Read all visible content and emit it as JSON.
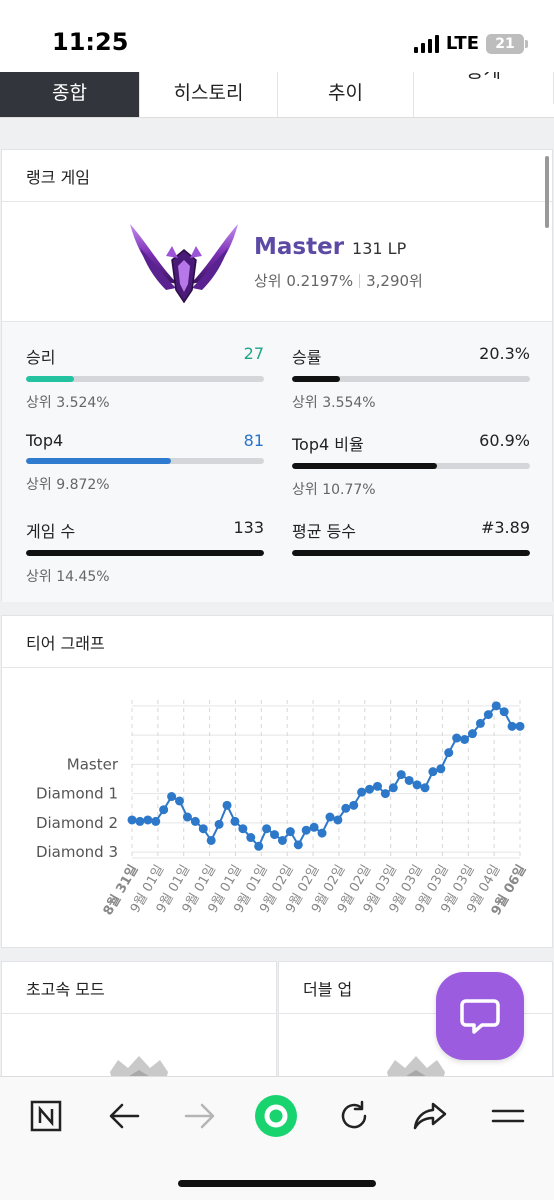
{
  "status_bar": {
    "time": "11:25",
    "network": "LTE",
    "battery": "21"
  },
  "tabs": [
    {
      "label": "종합",
      "active": true
    },
    {
      "label": "히스토리",
      "active": false
    },
    {
      "label": "추이",
      "active": false
    },
    {
      "label": "통계",
      "active": false
    }
  ],
  "rank": {
    "title": "랭크 게임",
    "tier": "Master",
    "lp": "131 LP",
    "top_percent": "상위 0.2197%",
    "rank_position": "3,290위",
    "stats": [
      {
        "label": "승리",
        "value": "27",
        "value_color": "#1fa48a",
        "bar_fraction": 0.203,
        "bar_color": "#23c2a0",
        "sub": "상위 3.524%"
      },
      {
        "label": "승률",
        "value": "20.3%",
        "value_color": "#222222",
        "bar_fraction": 0.203,
        "bar_color": "#111111",
        "sub": "상위 3.554%"
      },
      {
        "label": "Top4",
        "value": "81",
        "value_color": "#2a73c8",
        "bar_fraction": 0.609,
        "bar_color": "#2f7bd0",
        "sub": "상위 9.872%"
      },
      {
        "label": "Top4 비율",
        "value": "60.9%",
        "value_color": "#222222",
        "bar_fraction": 0.609,
        "bar_color": "#111111",
        "sub": "상위 10.77%"
      },
      {
        "label": "게임 수",
        "value": "133",
        "value_color": "#222222",
        "bar_fraction": 1.0,
        "bar_color": "#111111",
        "sub": "상위 14.45%"
      },
      {
        "label": "평균 등수",
        "value": "#3.89",
        "value_color": "#222222",
        "bar_fraction": 1.0,
        "bar_color": "#111111",
        "sub": ""
      }
    ]
  },
  "graph_title": "티어 그래프",
  "chart_data": {
    "type": "line",
    "title": "티어 그래프",
    "xlabel": "",
    "ylabel": "",
    "y_tick_labels": [
      "Diamond 3",
      "Diamond 2",
      "Diamond 1",
      "Master"
    ],
    "y_tick_values": [
      0,
      1,
      2,
      3
    ],
    "ylim": [
      -0.2,
      5.2
    ],
    "x_tick_labels": [
      "8월 31일",
      "9월 01일",
      "9월 01일",
      "9월 01일",
      "9월 01일",
      "9월 01일",
      "9월 02일",
      "9월 02일",
      "9월 02일",
      "9월 02일",
      "9월 03일",
      "9월 03일",
      "9월 03일",
      "9월 03일",
      "9월 04일",
      "9월 06일"
    ],
    "x_tick_bold": [
      true,
      false,
      false,
      false,
      false,
      false,
      false,
      false,
      false,
      false,
      false,
      false,
      false,
      false,
      false,
      true
    ],
    "series": [
      {
        "values": [
          1.1,
          1.05,
          1.1,
          1.05,
          1.45,
          1.9,
          1.75,
          1.2,
          1.05,
          0.8,
          0.4,
          0.95,
          1.6,
          1.05,
          0.8,
          0.5,
          0.2,
          0.8,
          0.6,
          0.4,
          0.7,
          0.25,
          0.75,
          0.85,
          0.65,
          1.2,
          1.1,
          1.5,
          1.6,
          2.05,
          2.15,
          2.25,
          2.0,
          2.2,
          2.65,
          2.45,
          2.3,
          2.2,
          2.75,
          2.85,
          3.4,
          3.9,
          3.85,
          4.05,
          4.4,
          4.7,
          5.0,
          4.8,
          4.3,
          4.3
        ]
      }
    ],
    "grid": true,
    "color": "#2d78c8"
  },
  "bottom_cards": [
    {
      "title": "초고속 모드"
    },
    {
      "title": "더블 업"
    }
  ],
  "nav_icons": [
    "n-logo-icon",
    "back-arrow-icon",
    "forward-arrow-icon",
    "home-dot-icon",
    "refresh-icon",
    "share-icon",
    "menu-icon"
  ]
}
